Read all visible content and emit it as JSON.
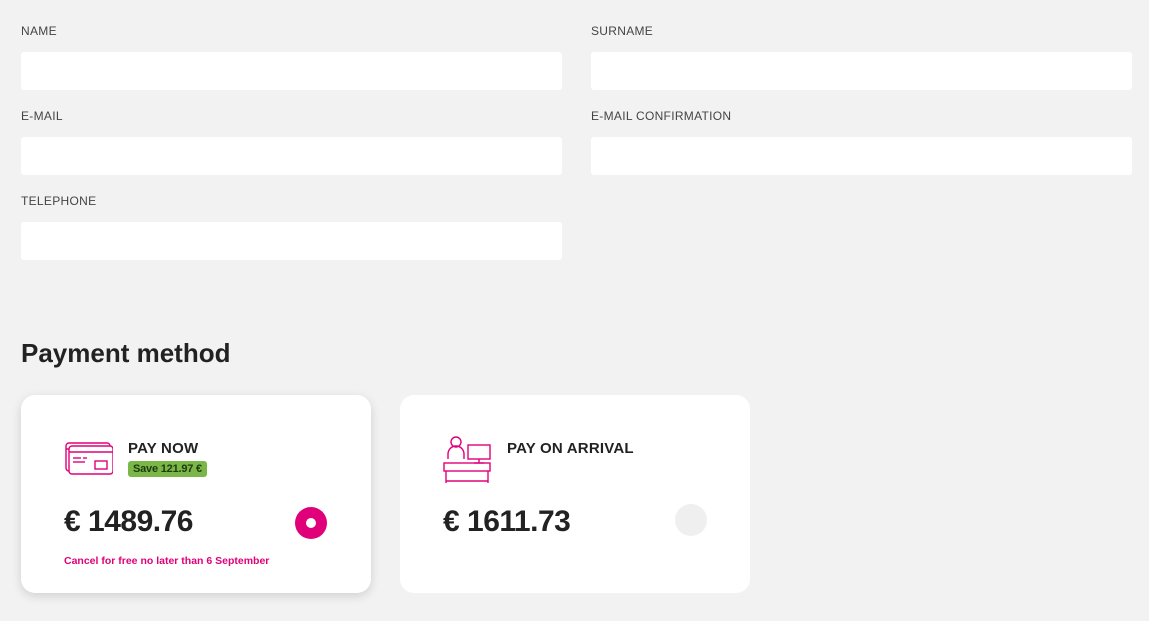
{
  "form": {
    "name": {
      "label": "NAME",
      "value": "",
      "placeholder": ""
    },
    "surname": {
      "label": "SURNAME",
      "value": "",
      "placeholder": ""
    },
    "email": {
      "label": "E-MAIL",
      "value": "",
      "placeholder": ""
    },
    "email_confirmation": {
      "label": "E-MAIL CONFIRMATION",
      "value": "",
      "placeholder": ""
    },
    "telephone": {
      "label": "TELEPHONE",
      "value": "",
      "placeholder": ""
    }
  },
  "payment": {
    "title": "Payment method",
    "options": [
      {
        "title": "PAY NOW",
        "badge": "Save 121.97 €",
        "price": "€ 1489.76",
        "note": "Cancel for free no later than 6 September",
        "icon": "credit-card-icon",
        "selected": true
      },
      {
        "title": "PAY ON ARRIVAL",
        "price": "€ 1611.73",
        "icon": "reception-desk-icon",
        "selected": false
      }
    ]
  },
  "colors": {
    "accent": "#e0007a",
    "badge_bg": "#7ab648",
    "page_bg": "#f2f2f2"
  }
}
